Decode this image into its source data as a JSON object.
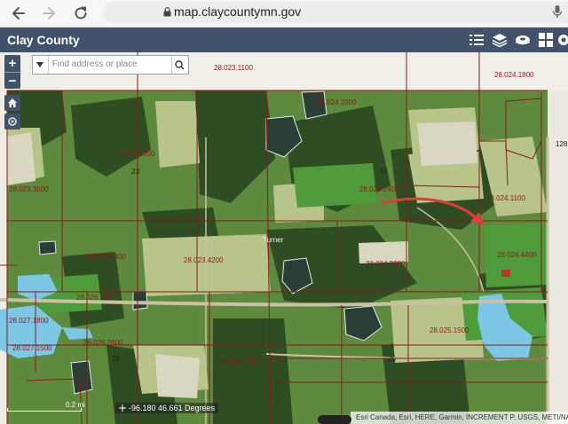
{
  "browser": {
    "url": "map.claycountymn.gov"
  },
  "app": {
    "title": "Clay County",
    "toolbar_icons": [
      "list-icon",
      "layers-icon",
      "measure-icon",
      "basemap-gallery-icon",
      "settings-icon"
    ]
  },
  "search": {
    "placeholder": "Find address or place"
  },
  "map": {
    "parcels": [
      {
        "id": "28.023.1100"
      },
      {
        "id": "28.024.1800"
      },
      {
        "id": "28.024.2000"
      },
      {
        "id": "28.023.1600"
      },
      {
        "id": "28.023.3500"
      },
      {
        "id": "28.024.1100"
      },
      {
        "id": "28.024.2400"
      },
      {
        "id": "28.023.3400"
      },
      {
        "id": "28.023.4200"
      },
      {
        "id": "28.024.3000"
      },
      {
        "id": "28.024.4400"
      },
      {
        "id": "28.026.2500"
      },
      {
        "id": "28.027.1500"
      },
      {
        "id": "28.027.1800"
      },
      {
        "id": "28.025.1500"
      },
      {
        "id": "28.026.0400"
      },
      {
        "id": "28.026.2800"
      }
    ],
    "road_labels": [
      "23",
      "24",
      "25",
      "25",
      "128"
    ],
    "place_label": "Turner",
    "scale_label": "0.2 mi",
    "coordinates": "-96.180 46.661 Degrees",
    "attribution": "Esri Canada, Esri, HERE, Garmin, INCREMENT P, USGS, METI/NASA"
  },
  "colors": {
    "header": "#42526b",
    "parcel_line": "#8a1a1a",
    "arrow": "#e23a3a",
    "water": "#7cc6e6"
  }
}
